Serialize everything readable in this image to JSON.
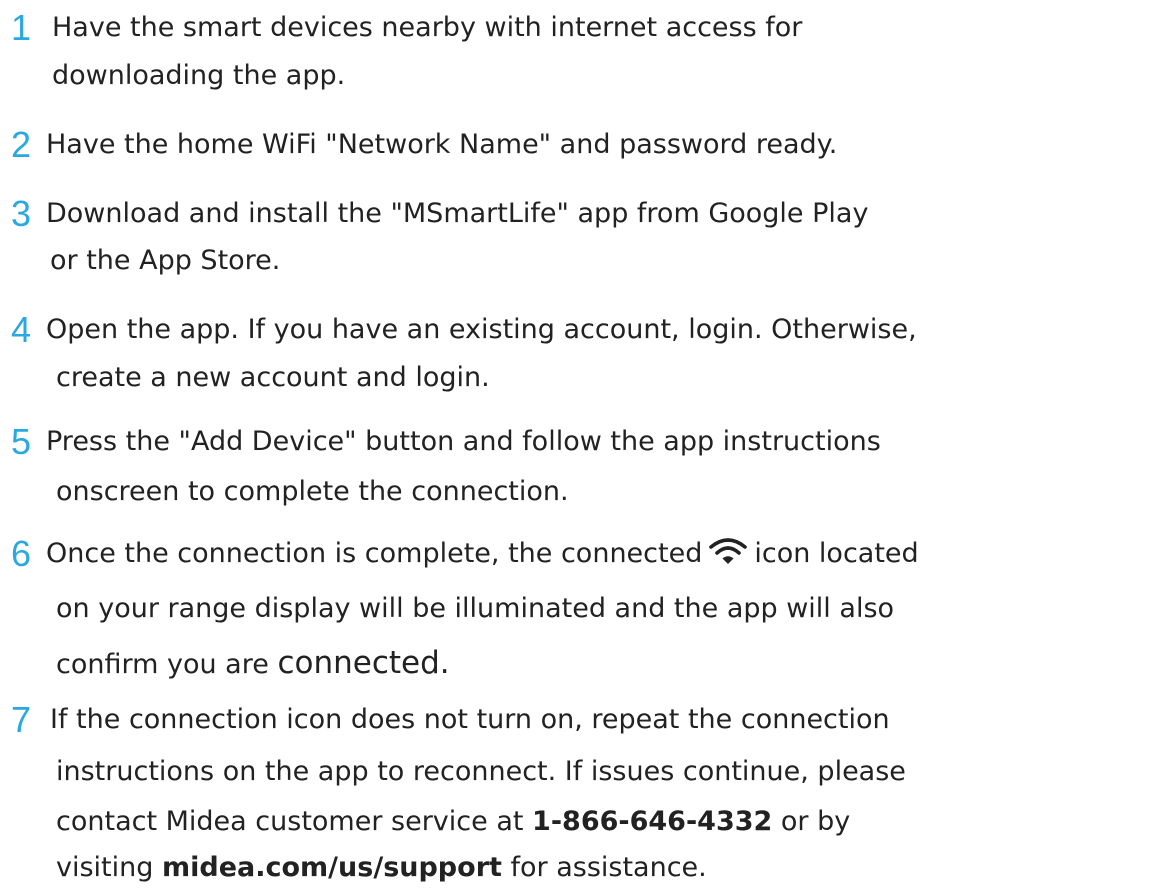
{
  "steps": [
    {
      "number": "1",
      "lines": [
        "Have the smart devices nearby with internet access for",
        "downloading the app."
      ]
    },
    {
      "number": "2",
      "lines": [
        "Have the home WiFi \"Network Name\" and password ready."
      ]
    },
    {
      "number": "3",
      "lines": [
        "Download and install the \"MSmartLife\" app from Google Play",
        "or the App Store."
      ]
    },
    {
      "number": "4",
      "lines": [
        "Open the app. If you have an existing account, login. Otherwise,",
        "create a new account and login."
      ]
    },
    {
      "number": "5",
      "lines": [
        "Press the \"Add Device\" button and follow the app instructions",
        "onscreen to  complete the connection."
      ]
    },
    {
      "number": "6",
      "line1_before": "Once the connection is complete, the connected",
      "line1_after": "icon located",
      "line2": "on your  range display will be illuminated and the app will also",
      "line3_a": "confirm you are ",
      "line3_b": "connected."
    },
    {
      "number": "7",
      "line1": "If the connection icon does not turn on, repeat the connection",
      "line2": "instructions on  the app to reconnect. If issues continue, please",
      "line3_before": "contact Midea customer  service at ",
      "phone": "1-866-646-4332",
      "line3_after": " or by",
      "line4_before": "visiting ",
      "url": "midea.com/us/support",
      "line4_after": " for assistance."
    }
  ],
  "icons": {
    "wifi": "wifi-icon"
  },
  "colors": {
    "accent": "#2aa8e0",
    "text": "#222222"
  }
}
